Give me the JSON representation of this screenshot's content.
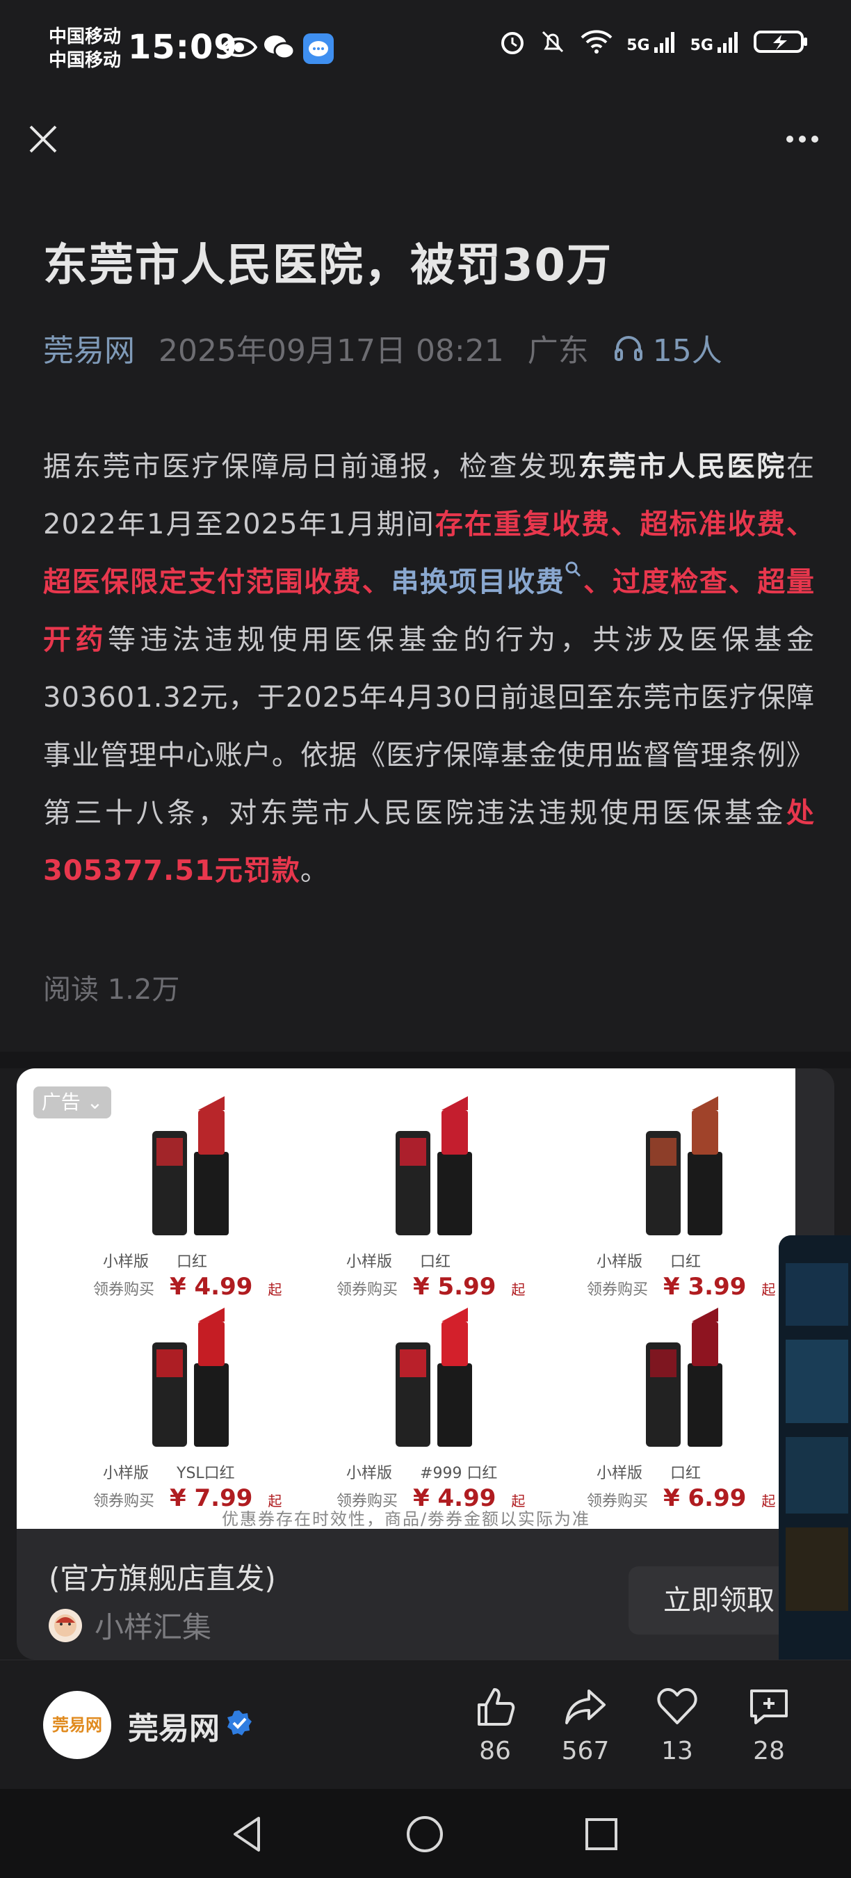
{
  "status_bar": {
    "carrier_1": "中国移动",
    "carrier_2": "中国移动",
    "time": "15:09",
    "signal_label_1": "5G",
    "signal_label_2": "5G"
  },
  "article": {
    "title": "东莞市人民医院，被罚30万",
    "source": "莞易网",
    "datetime": "2025年09月17日 08:21",
    "region": "广东",
    "listeners": "15人",
    "body": {
      "p1": "据东莞市医疗保障局日前通报，检查发现",
      "b1": "东莞市人民医院",
      "p2": "在2022年1月至2025年1月期间",
      "r1": "存在重复收费、超标准收费、超医保限定支付范围收费、",
      "link1": "串换项目收费",
      "r2": "、过度检查、超量开药",
      "p3": "等违法违规使用医保基金的行为，共涉及医保基金303601.32元，于2025年4月30日前退回至东莞市医疗保障事业管理中心账户。依据《医疗保障基金使用监督管理条例》第三十八条，对东莞市人民医院违法违规使用医保基金",
      "r3": "处305377.51元罚款",
      "p4": "。"
    },
    "reads": "阅读 1.2万"
  },
  "ad": {
    "badge": "广告",
    "products": [
      {
        "tag": "小样版",
        "name": "口红",
        "coupon": "领券购买",
        "price": "¥ 4.99",
        "suffix": "起",
        "color": "#b8262a"
      },
      {
        "tag": "小样版",
        "name": "口红",
        "coupon": "领券购买",
        "price": "¥ 5.99",
        "suffix": "起",
        "color": "#c41e2e"
      },
      {
        "tag": "小样版",
        "name": "口红",
        "coupon": "领券购买",
        "price": "¥ 3.99",
        "suffix": "起",
        "color": "#a0432a"
      },
      {
        "tag": "小样版",
        "name": "YSL口红",
        "coupon": "领券购买",
        "price": "¥ 7.99",
        "suffix": "起",
        "color": "#c51d24"
      },
      {
        "tag": "小样版",
        "name": "#999 口红",
        "coupon": "领券购买",
        "price": "¥ 4.99",
        "suffix": "起",
        "color": "#d3202b"
      },
      {
        "tag": "小样版",
        "name": "口红",
        "coupon": "领券购买",
        "price": "¥ 6.99",
        "suffix": "起",
        "color": "#8e1420"
      }
    ],
    "disclaimer": "优惠券存在时效性，商品/劵券金额以实际为准",
    "subtitle": "(官方旗舰店直发)",
    "advertiser": "小样汇集",
    "cta": "立即领取"
  },
  "bottom_bar": {
    "author": "莞易网",
    "author_logo_text": "莞易网",
    "likes": "86",
    "shares": "567",
    "favorites": "13",
    "comments": "28"
  }
}
